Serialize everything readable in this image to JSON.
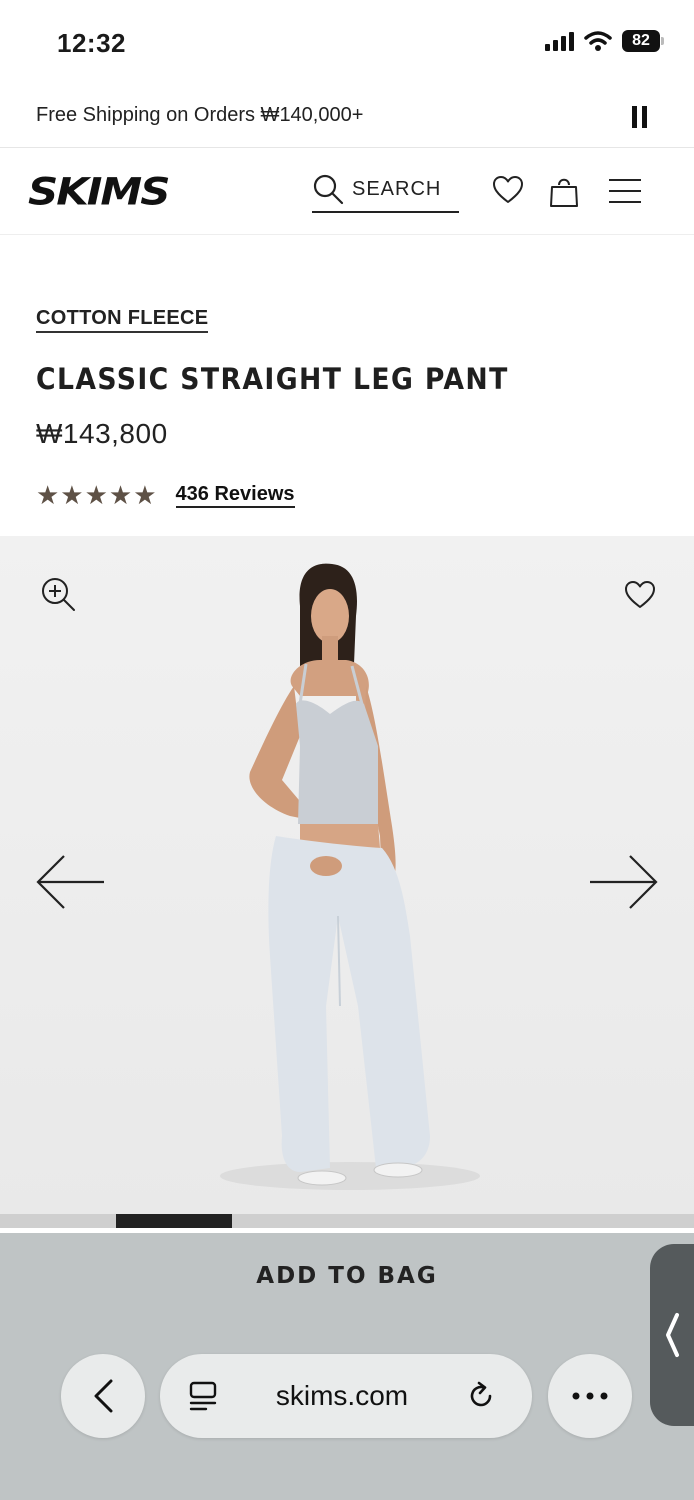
{
  "status_bar": {
    "time": "12:32",
    "battery": "82"
  },
  "promo": {
    "text": "Free Shipping on Orders ₩140,000+"
  },
  "header": {
    "logo": "SKIMS",
    "search_label": "SEARCH"
  },
  "product": {
    "collection": "COTTON FLEECE",
    "title": "CLASSIC STRAIGHT LEG PANT",
    "price": "₩143,800",
    "rating": 5,
    "stars": "★★★★★",
    "reviews_label": "436 Reviews"
  },
  "gallery": {
    "progress_fraction": 0.167
  },
  "cta": {
    "add_to_bag": "ADD TO BAG"
  },
  "browser": {
    "url": "skims.com"
  },
  "icons": [
    "signal-icon",
    "wifi-icon",
    "battery-icon",
    "pause-icon",
    "search-icon",
    "heart-icon",
    "bag-icon",
    "menu-icon",
    "zoom-in-icon",
    "arrow-left-icon",
    "arrow-right-icon",
    "back-icon",
    "tabs-icon",
    "reload-icon",
    "more-icon",
    "collapse-handle-icon"
  ]
}
